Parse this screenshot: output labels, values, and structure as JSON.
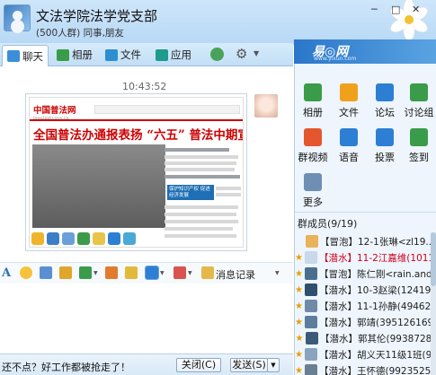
{
  "window": {
    "title": "文法学院法学党支部",
    "subtitle": "(500人群) 同事,朋友"
  },
  "tabs": [
    {
      "label": "聊天",
      "icon": "chat-icon"
    },
    {
      "label": "相册",
      "icon": "album-icon"
    },
    {
      "label": "文件",
      "icon": "file-icon"
    },
    {
      "label": "应用",
      "icon": "apps-icon"
    }
  ],
  "ad": {
    "logo": "易◎网",
    "url": "www.yixun.com"
  },
  "chat": {
    "timestamp": "10:43:52",
    "screenshot": {
      "site_logo": "中国普法网",
      "site_url": "legalinfo.gov.cn",
      "headline": "全国普法办通报表扬 “六五” 普法中期宣",
      "photo_caption": "保护知识产权 促进经济发展"
    }
  },
  "input_toolbar": {
    "history_label": "消息记录"
  },
  "bottom": {
    "status_text": "还不点？好工作都被抢走了！",
    "close_label": "关闭(C)",
    "send_label": "发送(S)"
  },
  "apps": [
    {
      "label": "相册",
      "icon": "album-icon",
      "color": "#3a9c4a"
    },
    {
      "label": "文件",
      "icon": "folder-icon",
      "color": "#f0a11c"
    },
    {
      "label": "论坛",
      "icon": "forum-icon",
      "color": "#2d7fd3"
    },
    {
      "label": "讨论组",
      "icon": "discussion-icon",
      "color": "#3a9c4a"
    },
    {
      "label": "群视频",
      "icon": "video-icon",
      "color": "#e4572e"
    },
    {
      "label": "语音",
      "icon": "voice-icon",
      "color": "#2d7fd3"
    },
    {
      "label": "投票",
      "icon": "vote-icon",
      "color": "#2d7fd3"
    },
    {
      "label": "签到",
      "icon": "checkin-icon",
      "color": "#3a9c4a"
    },
    {
      "label": "更多",
      "icon": "more-icon",
      "color": "#6e8fb3"
    }
  ],
  "members": {
    "header": "群成员(9/19)",
    "list": [
      {
        "tag": "【冒泡】",
        "name": "12-1张琳<zl19...",
        "red": false,
        "star": false
      },
      {
        "tag": "【潜水】",
        "name": "11-2江嘉维(1011...",
        "red": true,
        "star": true
      },
      {
        "tag": "【冒泡】",
        "name": "陈仁刚<rain.and....",
        "red": false,
        "star": true
      },
      {
        "tag": "【潜水】",
        "name": "10-3赵梁(124197...",
        "red": false,
        "star": true
      },
      {
        "tag": "【潜水】",
        "name": "11-1孙静(494622...",
        "red": false,
        "star": true
      },
      {
        "tag": "【潜水】",
        "name": "郭靖(395126169)",
        "red": false,
        "star": true
      },
      {
        "tag": "【潜水】",
        "name": "郭其伦(9938728)",
        "red": false,
        "star": true
      },
      {
        "tag": "【潜水】",
        "name": "胡义天11级1班(9...",
        "red": false,
        "star": true
      },
      {
        "tag": "【潜水】",
        "name": "王怀德(99235250)",
        "red": false,
        "star": true
      }
    ]
  }
}
